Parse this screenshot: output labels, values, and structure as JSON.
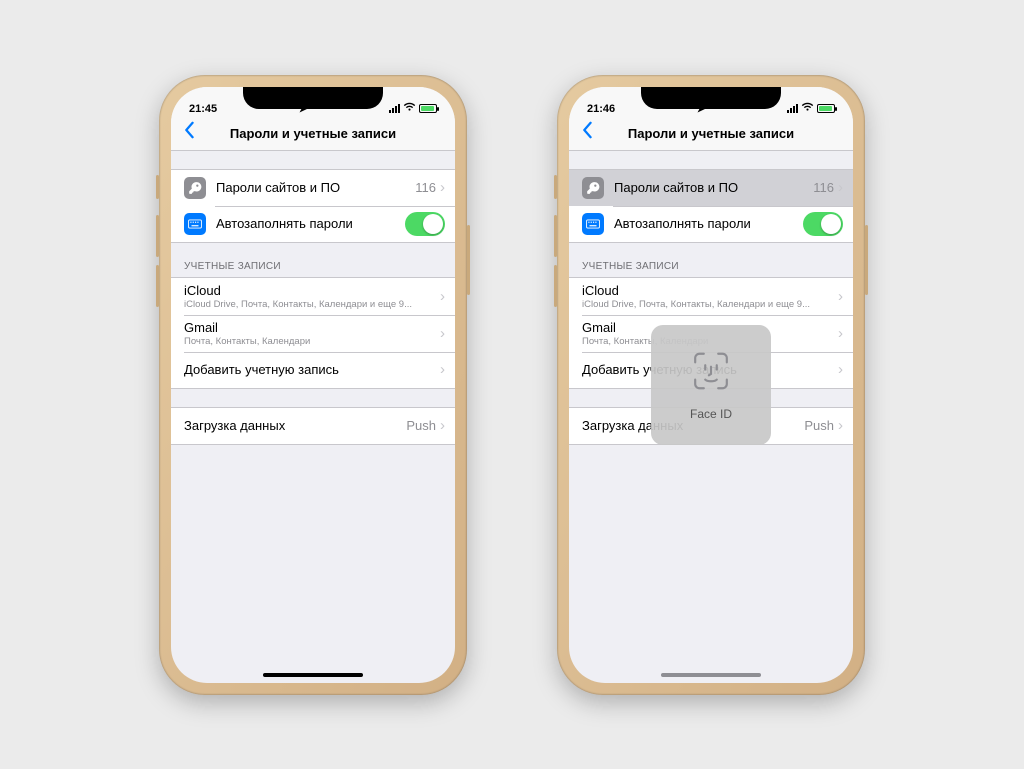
{
  "phones": [
    {
      "status": {
        "time": "21:45"
      },
      "nav": {
        "title": "Пароли и учетные записи"
      },
      "rows": {
        "passwords": {
          "label": "Пароли сайтов и ПО",
          "count": "116"
        },
        "autofill": {
          "label": "Автозаполнять пароли"
        }
      },
      "accounts_header": "УЧЕТНЫЕ ЗАПИСИ",
      "accounts": [
        {
          "title": "iCloud",
          "sub": "iCloud Drive, Почта, Контакты, Календари и еще 9..."
        },
        {
          "title": "Gmail",
          "sub": "Почта, Контакты, Календари"
        },
        {
          "title": "Добавить учетную запись",
          "sub": ""
        }
      ],
      "fetch": {
        "label": "Загрузка данных",
        "value": "Push"
      },
      "pressed_passwords": false,
      "show_faceid": false,
      "home_dim": false
    },
    {
      "status": {
        "time": "21:46"
      },
      "nav": {
        "title": "Пароли и учетные записи"
      },
      "rows": {
        "passwords": {
          "label": "Пароли сайтов и ПО",
          "count": "116"
        },
        "autofill": {
          "label": "Автозаполнять пароли"
        }
      },
      "accounts_header": "УЧЕТНЫЕ ЗАПИСИ",
      "accounts": [
        {
          "title": "iCloud",
          "sub": "iCloud Drive, Почта, Контакты, Календари и еще 9..."
        },
        {
          "title": "Gmail",
          "sub": "Почта, Контакты, Календари"
        },
        {
          "title": "Добавить учетную запись",
          "sub": ""
        }
      ],
      "fetch": {
        "label": "Загрузка данных",
        "value": "Push"
      },
      "pressed_passwords": true,
      "show_faceid": true,
      "faceid_label": "Face ID",
      "home_dim": true
    }
  ]
}
